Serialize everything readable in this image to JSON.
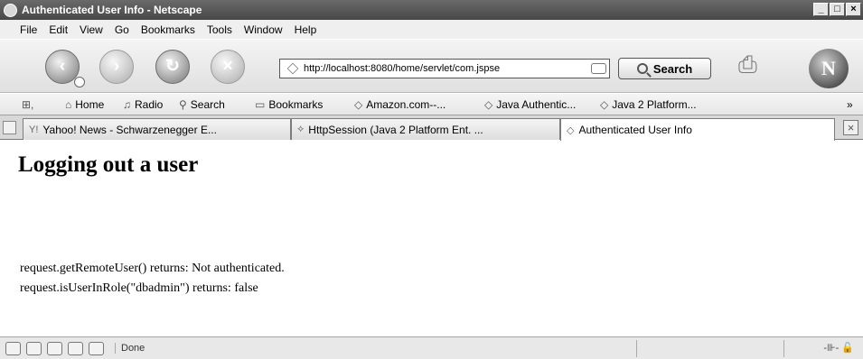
{
  "window": {
    "title": "Authenticated User Info - Netscape",
    "minimize": "_",
    "maximize": "□",
    "close": "×"
  },
  "menu": [
    "File",
    "Edit",
    "View",
    "Go",
    "Bookmarks",
    "Tools",
    "Window",
    "Help"
  ],
  "navbar": {
    "back": "‹",
    "forward": "›",
    "reload": "↻",
    "stop": "×",
    "url": "http://localhost:8080/home/servlet/com.jspse",
    "search_label": "Search"
  },
  "bookmarks": {
    "home": "Home",
    "radio": "Radio",
    "search": "Search",
    "bookmarks": "Bookmarks",
    "items": [
      "Amazon.com--...",
      "Java Authentic...",
      "Java 2 Platform..."
    ],
    "more": "»"
  },
  "tabs": [
    {
      "label": "Yahoo! News - Schwarzenegger E...",
      "glyph": "Y!"
    },
    {
      "label": "HttpSession (Java 2 Platform Ent. ...",
      "glyph": "⟡"
    },
    {
      "label": "Authenticated User Info",
      "glyph": "◇"
    }
  ],
  "page": {
    "heading": "Logging out a user",
    "line1": "request.getRemoteUser() returns: Not authenticated.",
    "line2": "request.isUserInRole(\"dbadmin\") returns: false"
  },
  "statusbar": {
    "text": "Done",
    "lock": "-⊪- 🔓"
  }
}
